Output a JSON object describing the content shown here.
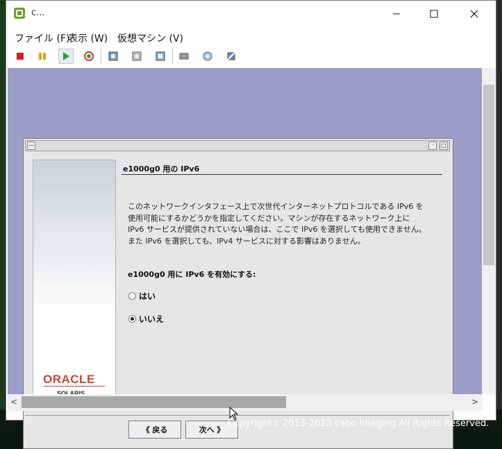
{
  "window": {
    "title": "c..."
  },
  "menu": [
    {
      "label": "ファイル (F)"
    },
    {
      "label": "表示 (W)"
    },
    {
      "label": "仮想マシン (V)"
    }
  ],
  "dialog": {
    "heading": "e1000g0 用の IPv6",
    "description": "このネットワークインタフェース上で次世代インターネットプロトコルである IPv6 を使用可能にするかどうかを指定してください。マシンが存在するネットワーク上に IPv6 サービスが提供されていない場合は、ここで IPv6 を選択しても使用できません。また IPv6 を選択しても、IPv4 サービスに対する影響はありません。",
    "question": "e1000g0 用に IPv6 を有効にする:",
    "options": [
      {
        "label": "はい",
        "selected": false
      },
      {
        "label": "いいえ",
        "selected": true
      }
    ],
    "back_button": "《 戻る",
    "next_button": "次へ 》"
  },
  "branding": {
    "logo": "ORACLE",
    "product": "SOLARIS"
  },
  "footer": {
    "copyright": "Copyright c 2013-2023 cabo Imaging All Rights Reserved."
  },
  "colors": {
    "vm_background": "#9d9dc9",
    "oracle_red": "#c74634"
  }
}
